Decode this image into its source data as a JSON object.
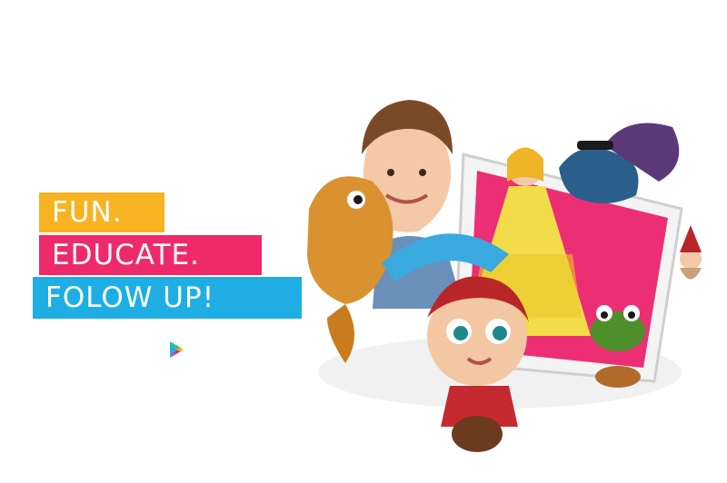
{
  "slogan": {
    "line1": "FUN.",
    "line2": "EDUCATE.",
    "line3": "FOLOW UP!"
  },
  "colors": {
    "yellow": "#f7b321",
    "pink": "#ee2a6b",
    "blue": "#1eaee4"
  },
  "store_button": {
    "icon": "google-play-icon"
  }
}
